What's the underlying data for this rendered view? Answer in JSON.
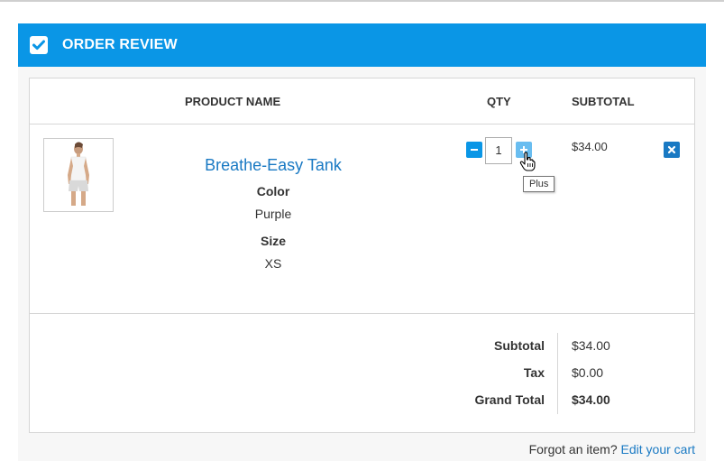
{
  "header": {
    "title": "ORDER REVIEW",
    "bg_color": "#0a96e6"
  },
  "table": {
    "columns": {
      "product_name": "PRODUCT NAME",
      "qty": "QTY",
      "subtotal": "SUBTOTAL"
    },
    "items": [
      {
        "name": "Breathe-Easy Tank",
        "options": [
          {
            "label": "Color",
            "value": "Purple"
          },
          {
            "label": "Size",
            "value": "XS"
          }
        ],
        "qty": "1",
        "subtotal": "$34.00",
        "qty_plus_tooltip": "Plus"
      }
    ]
  },
  "totals": {
    "subtotal_label": "Subtotal",
    "subtotal_value": "$34.00",
    "tax_label": "Tax",
    "tax_value": "$0.00",
    "grand_total_label": "Grand Total",
    "grand_total_value": "$34.00"
  },
  "footer": {
    "note": "Forgot an item?",
    "link": "Edit your cart"
  },
  "colors": {
    "accent": "#0a96e6",
    "link": "#1979c3"
  },
  "icons": [
    "checkbox-checked-icon",
    "minus-icon",
    "plus-icon",
    "remove-icon",
    "hand-cursor-icon"
  ]
}
